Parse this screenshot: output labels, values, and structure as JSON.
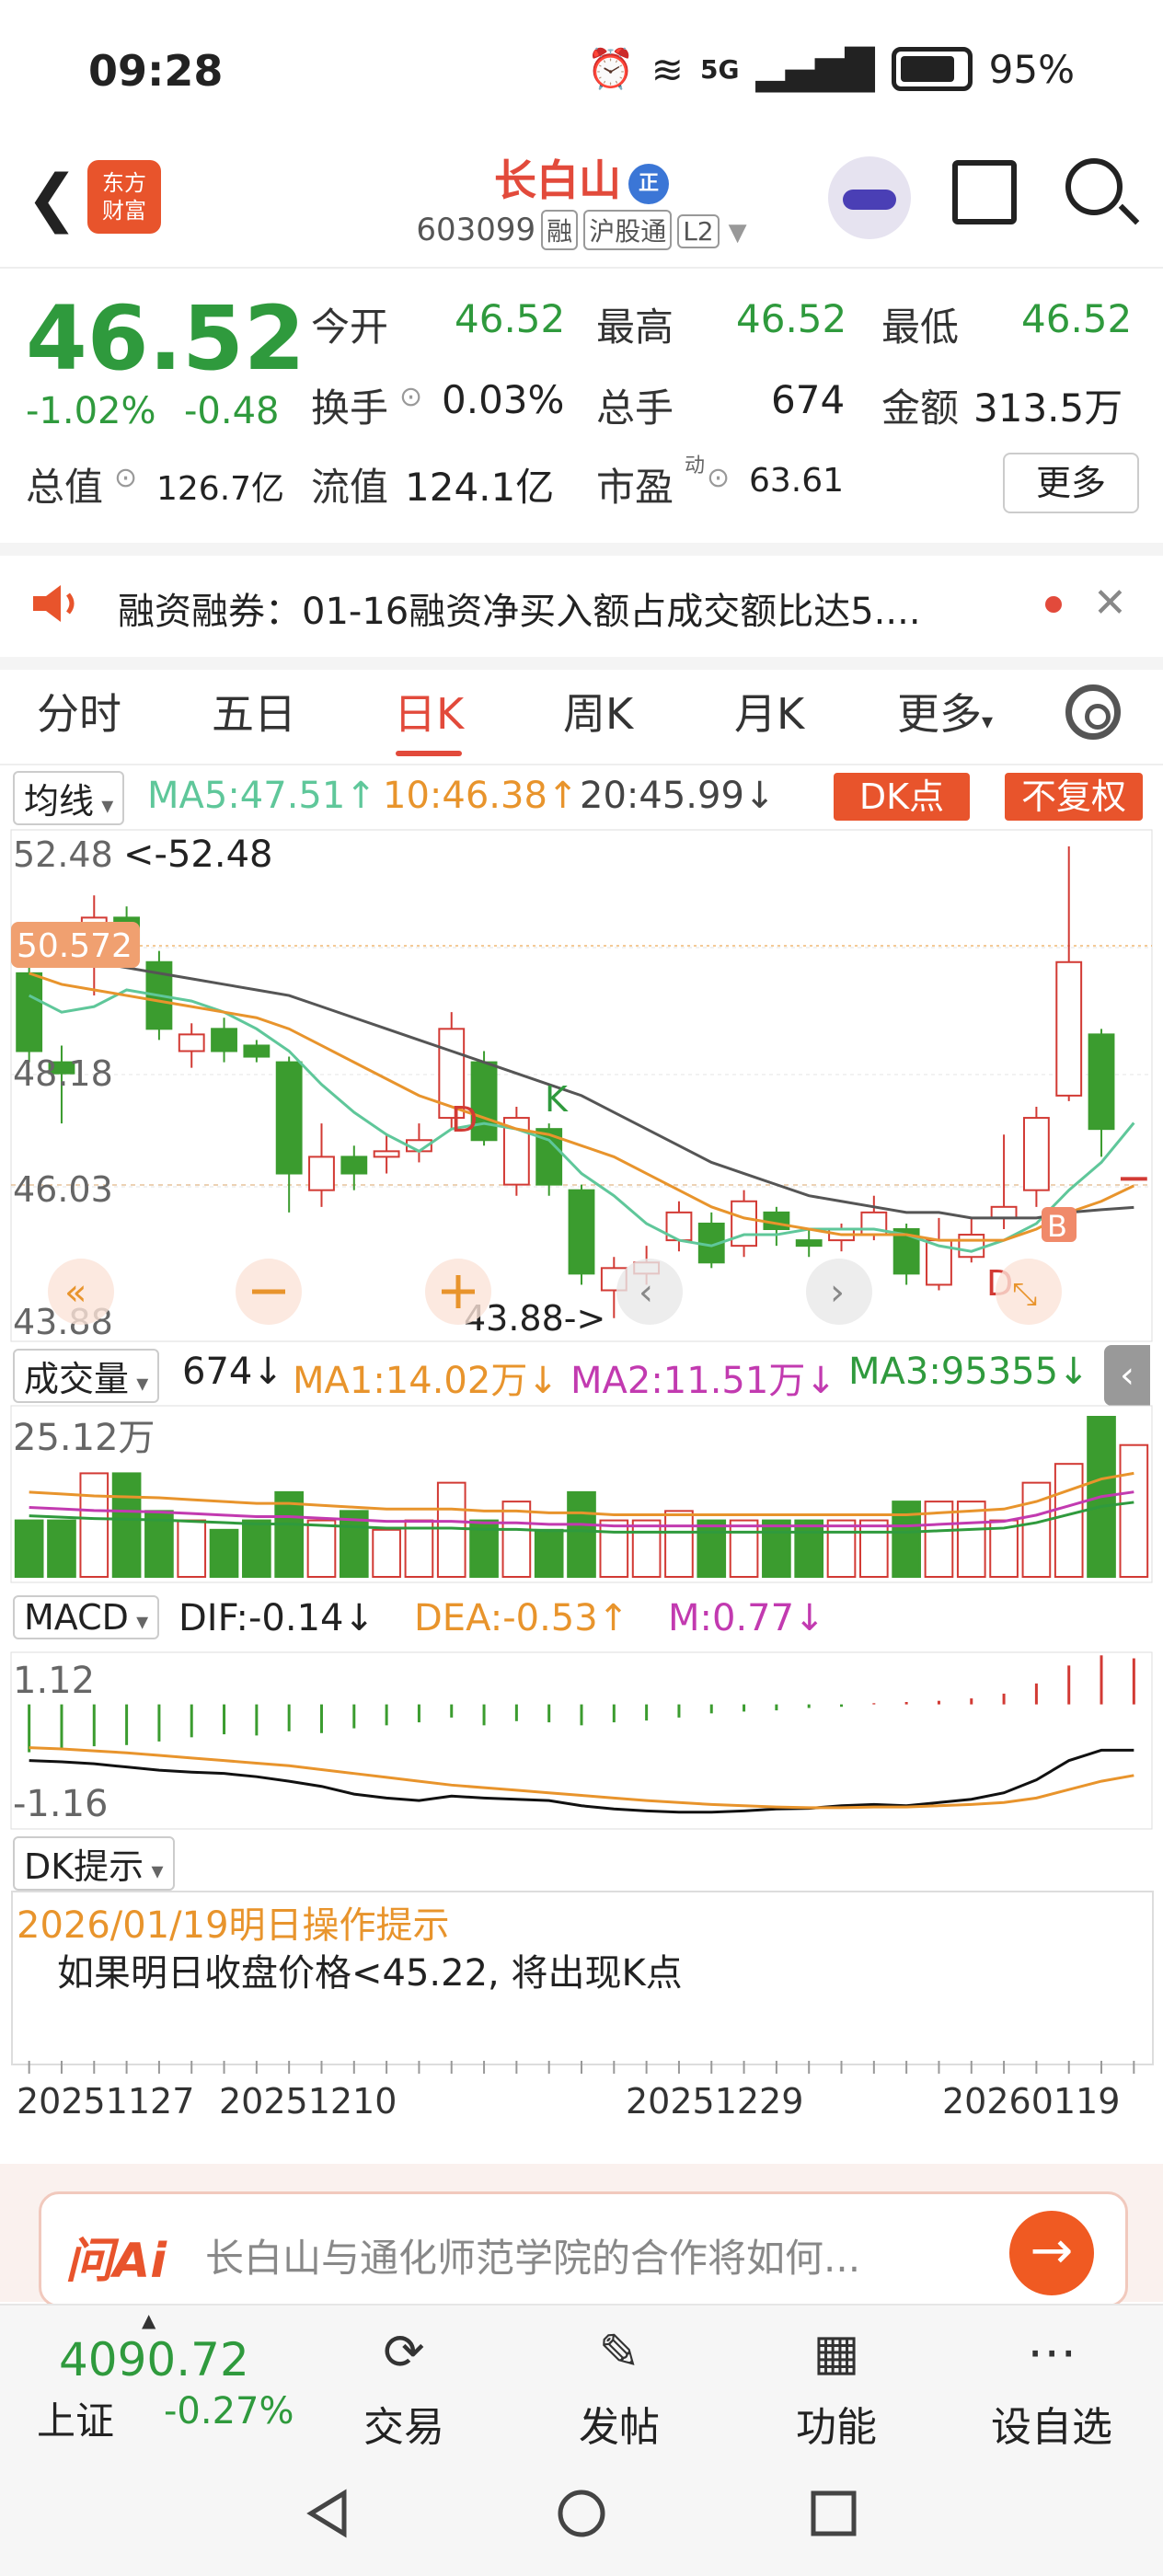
{
  "status": {
    "time": "09:28",
    "battery": "95%",
    "network": "5G"
  },
  "header": {
    "name": "长白山",
    "badge": "正",
    "code": "603099",
    "tags": [
      "融",
      "沪股通",
      "L2"
    ],
    "logo_line1": "东方",
    "logo_line2": "财富"
  },
  "quote": {
    "price": "46.52",
    "pct": "-1.02%",
    "chg": "-0.48",
    "open_label": "今开",
    "open": "46.52",
    "high_label": "最高",
    "high": "46.52",
    "low_label": "最低",
    "low": "46.52",
    "turnover_label": "换手",
    "turnover": "0.03%",
    "vol_label": "总手",
    "vol": "674",
    "amt_label": "金额",
    "amt": "313.5万",
    "mcap_label": "总值",
    "mcap": "126.7亿",
    "float_label": "流值",
    "float": "124.1亿",
    "pe_label": "市盈",
    "pe_sup": "动",
    "pe": "63.61",
    "more": "更多"
  },
  "ticker": {
    "text": "融资融券：01-16融资净买入额占成交额比达5...."
  },
  "tabs": [
    "分时",
    "五日",
    "日K",
    "周K",
    "月K",
    "更多"
  ],
  "active_tab": "日K",
  "ma": {
    "selector": "均线",
    "ma5": "MA5:47.51↑",
    "ma10": "10:46.38↑",
    "ma20": "20:45.99↓",
    "dk": "DK点",
    "fq": "不复权"
  },
  "kline": {
    "y_labels": [
      "52.48",
      "48.18",
      "46.03",
      "43.88"
    ],
    "max_note": "<-52.48",
    "min_note": "43.88->",
    "marker": "50.572",
    "signals": [
      "D",
      "K",
      "D",
      "B"
    ]
  },
  "volume": {
    "selector": "成交量",
    "v": "674↓",
    "ma1": "MA1:14.02万↓",
    "ma2": "MA2:11.51万↓",
    "ma3": "MA3:95355↓",
    "max": "25.12万"
  },
  "macd": {
    "selector": "MACD",
    "dif": "DIF:-0.14↓",
    "dea": "DEA:-0.53↑",
    "m": "M:0.77↓",
    "top": "1.12",
    "bottom": "-1.16"
  },
  "dk": {
    "selector": "DK提示",
    "title": "2026/01/19明日操作提示",
    "text": "如果明日收盘价格<45.22, 将出现K点"
  },
  "dates": [
    "20251127",
    "20251210",
    "20251229",
    "20260119"
  ],
  "ai": {
    "logo": "问Ai",
    "text": "长白山与通化师范学院的合作将如何..."
  },
  "bottom_nav": {
    "index_value": "4090.72",
    "index_name": "上证",
    "index_pct": "-0.27%",
    "items": [
      "交易",
      "发帖",
      "功能",
      "设自选"
    ]
  },
  "chart_data": {
    "type": "candlestick",
    "up_color": "#d23a34",
    "down_color": "#3b9c2f",
    "ylim": [
      43.88,
      52.48
    ],
    "y_ticks": [
      52.48,
      48.18,
      46.03,
      43.88
    ],
    "candles": [
      {
        "o": 50.2,
        "c": 48.8,
        "h": 50.5,
        "l": 48.6
      },
      {
        "o": 48.6,
        "c": 48.4,
        "h": 48.9,
        "l": 47.5
      },
      {
        "o": 50.4,
        "c": 51.2,
        "h": 51.6,
        "l": 49.8
      },
      {
        "o": 51.2,
        "c": 50.6,
        "h": 51.4,
        "l": 50.3
      },
      {
        "o": 50.4,
        "c": 49.2,
        "h": 50.6,
        "l": 49.0
      },
      {
        "o": 48.8,
        "c": 49.1,
        "h": 49.3,
        "l": 48.5
      },
      {
        "o": 49.2,
        "c": 48.8,
        "h": 49.4,
        "l": 48.6
      },
      {
        "o": 48.9,
        "c": 48.7,
        "h": 49.0,
        "l": 48.6
      },
      {
        "o": 48.6,
        "c": 46.6,
        "h": 48.7,
        "l": 45.9
      },
      {
        "o": 46.3,
        "c": 46.9,
        "h": 47.5,
        "l": 46.0
      },
      {
        "o": 46.9,
        "c": 46.6,
        "h": 47.1,
        "l": 46.3
      },
      {
        "o": 46.9,
        "c": 47.0,
        "h": 47.3,
        "l": 46.6
      },
      {
        "o": 47.0,
        "c": 47.2,
        "h": 47.5,
        "l": 46.8
      },
      {
        "o": 47.6,
        "c": 49.2,
        "h": 49.5,
        "l": 47.4
      },
      {
        "o": 48.6,
        "c": 47.2,
        "h": 48.8,
        "l": 47.1
      },
      {
        "o": 46.4,
        "c": 47.6,
        "h": 47.8,
        "l": 46.2
      },
      {
        "o": 47.4,
        "c": 46.4,
        "h": 47.5,
        "l": 46.2
      },
      {
        "o": 46.3,
        "c": 44.8,
        "h": 46.4,
        "l": 44.6
      },
      {
        "o": 44.5,
        "c": 44.9,
        "h": 45.1,
        "l": 44.0
      },
      {
        "o": 44.8,
        "c": 45.0,
        "h": 45.3,
        "l": 44.6
      },
      {
        "o": 45.4,
        "c": 45.9,
        "h": 46.1,
        "l": 45.2
      },
      {
        "o": 45.7,
        "c": 45.0,
        "h": 45.9,
        "l": 44.9
      },
      {
        "o": 45.3,
        "c": 46.1,
        "h": 46.3,
        "l": 45.1
      },
      {
        "o": 45.9,
        "c": 45.6,
        "h": 46.0,
        "l": 45.3
      },
      {
        "o": 45.4,
        "c": 45.3,
        "h": 45.6,
        "l": 45.1
      },
      {
        "o": 45.4,
        "c": 45.6,
        "h": 45.7,
        "l": 45.2
      },
      {
        "o": 45.5,
        "c": 45.9,
        "h": 46.2,
        "l": 45.4
      },
      {
        "o": 45.6,
        "c": 44.8,
        "h": 45.7,
        "l": 44.6
      },
      {
        "o": 44.6,
        "c": 45.4,
        "h": 45.8,
        "l": 44.5
      },
      {
        "o": 45.1,
        "c": 45.5,
        "h": 45.8,
        "l": 45.0
      },
      {
        "o": 45.8,
        "c": 46.0,
        "h": 47.3,
        "l": 45.6
      },
      {
        "o": 46.3,
        "c": 47.6,
        "h": 47.8,
        "l": 46.0
      },
      {
        "o": 48.0,
        "c": 50.4,
        "h": 52.48,
        "l": 47.9
      },
      {
        "o": 49.1,
        "c": 47.4,
        "h": 49.2,
        "l": 46.9
      },
      {
        "o": 46.52,
        "c": 46.52,
        "h": 46.52,
        "l": 46.52
      }
    ],
    "ma5": [
      49.8,
      49.5,
      49.6,
      49.9,
      49.8,
      49.7,
      49.5,
      49.2,
      48.8,
      48.2,
      47.7,
      47.3,
      47.0,
      47.4,
      47.5,
      47.4,
      47.2,
      46.6,
      46.2,
      45.7,
      45.4,
      45.3,
      45.5,
      45.5,
      45.6,
      45.6,
      45.6,
      45.5,
      45.3,
      45.2,
      45.4,
      45.7,
      46.3,
      46.8,
      47.51
    ],
    "ma10": [
      50.2,
      50.0,
      49.9,
      49.8,
      49.7,
      49.6,
      49.5,
      49.4,
      49.2,
      48.9,
      48.6,
      48.3,
      48.0,
      47.8,
      47.6,
      47.4,
      47.3,
      47.1,
      46.9,
      46.6,
      46.3,
      46.0,
      45.8,
      45.7,
      45.6,
      45.5,
      45.5,
      45.5,
      45.4,
      45.4,
      45.4,
      45.6,
      45.9,
      46.1,
      46.38
    ],
    "ma20": [
      50.6,
      50.5,
      50.4,
      50.3,
      50.2,
      50.1,
      50.0,
      49.9,
      49.8,
      49.6,
      49.4,
      49.2,
      49.0,
      48.8,
      48.6,
      48.4,
      48.2,
      48.0,
      47.7,
      47.4,
      47.1,
      46.8,
      46.6,
      46.4,
      46.2,
      46.1,
      46.0,
      45.9,
      45.9,
      45.8,
      45.8,
      45.8,
      45.9,
      45.95,
      45.99
    ],
    "volume": {
      "max": 251200,
      "values": [
        60,
        60,
        110,
        110,
        70,
        60,
        50,
        60,
        90,
        60,
        70,
        50,
        60,
        100,
        60,
        80,
        50,
        90,
        60,
        60,
        70,
        60,
        60,
        60,
        60,
        60,
        60,
        80,
        80,
        80,
        60,
        100,
        120,
        170,
        140
      ],
      "ma1": [
        90,
        88,
        86,
        85,
        84,
        82,
        80,
        78,
        78,
        76,
        74,
        72,
        72,
        72,
        70,
        70,
        68,
        68,
        66,
        66,
        66,
        66,
        66,
        66,
        66,
        66,
        66,
        66,
        68,
        70,
        72,
        80,
        92,
        104,
        110
      ]
    },
    "macd": {
      "ylim": [
        -1.16,
        1.12
      ],
      "hist": [
        -0.8,
        -0.75,
        -0.7,
        -0.68,
        -0.62,
        -0.55,
        -0.5,
        -0.52,
        -0.45,
        -0.48,
        -0.4,
        -0.35,
        -0.3,
        -0.22,
        -0.35,
        -0.28,
        -0.3,
        -0.35,
        -0.3,
        -0.27,
        -0.22,
        -0.15,
        -0.12,
        -0.1,
        -0.06,
        -0.04,
        0.02,
        0.04,
        0.06,
        0.1,
        0.18,
        0.35,
        0.65,
        0.82,
        0.77
      ],
      "dif": [
        -0.3,
        -0.32,
        -0.35,
        -0.4,
        -0.45,
        -0.48,
        -0.5,
        -0.55,
        -0.62,
        -0.7,
        -0.82,
        -0.88,
        -0.92,
        -0.85,
        -0.88,
        -0.9,
        -0.92,
        -1.0,
        -1.05,
        -1.08,
        -1.1,
        -1.1,
        -1.08,
        -1.05,
        -1.04,
        -1.0,
        -0.98,
        -1.0,
        -0.95,
        -0.9,
        -0.8,
        -0.6,
        -0.3,
        -0.14,
        -0.14
      ],
      "dea": [
        -0.1,
        -0.12,
        -0.15,
        -0.18,
        -0.22,
        -0.26,
        -0.3,
        -0.34,
        -0.38,
        -0.44,
        -0.5,
        -0.56,
        -0.62,
        -0.68,
        -0.72,
        -0.76,
        -0.8,
        -0.84,
        -0.88,
        -0.92,
        -0.95,
        -0.98,
        -1.0,
        -1.02,
        -1.03,
        -1.03,
        -1.02,
        -1.02,
        -1.0,
        -0.98,
        -0.95,
        -0.88,
        -0.75,
        -0.62,
        -0.53
      ]
    }
  }
}
